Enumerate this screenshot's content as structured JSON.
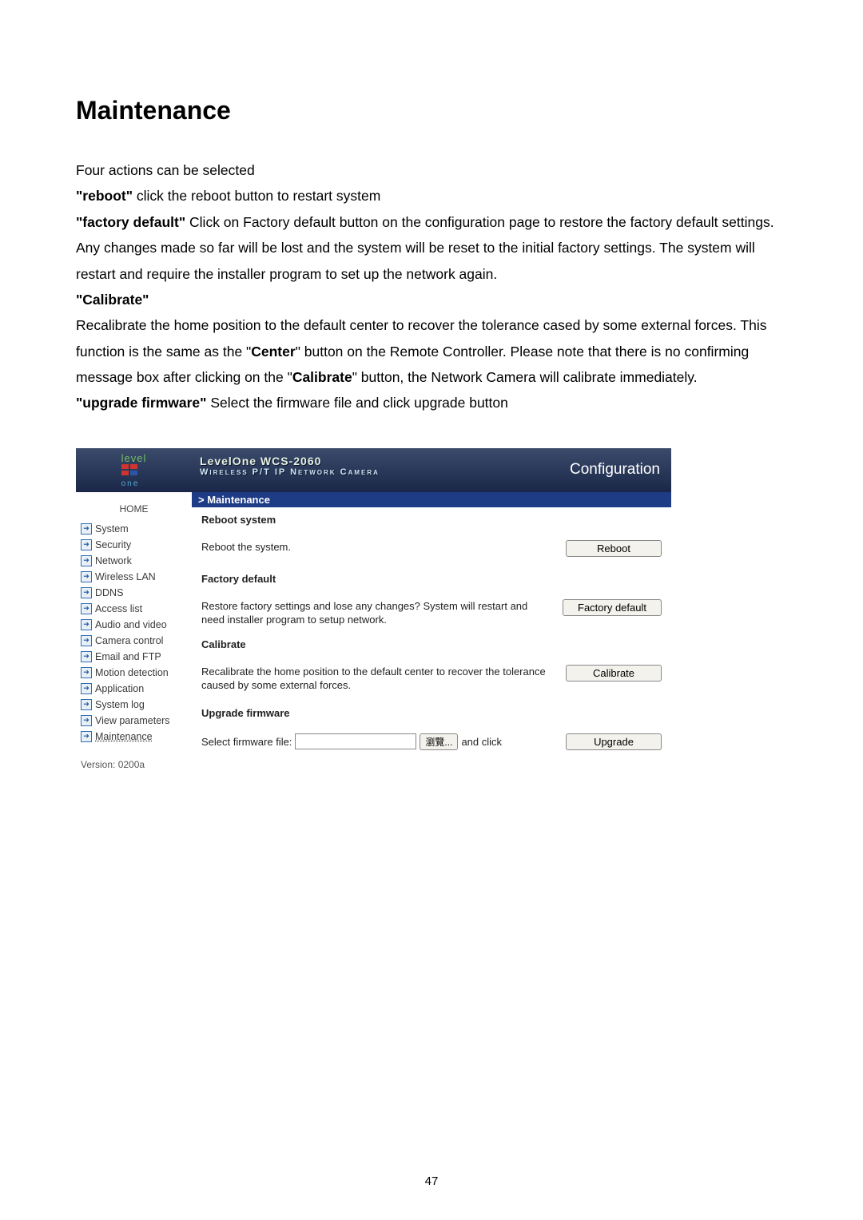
{
  "doc": {
    "title": "Maintenance",
    "intro": "Four actions can be selected",
    "reboot_label": "\"reboot\"",
    "reboot_text": " click the reboot button to restart system",
    "factory_label": "\"factory default\"",
    "factory_text": " Click on Factory default button on the configuration page to restore the factory default settings. Any changes made so far will be lost and the system will be reset to the initial factory settings. The system will restart and require the installer program to set up the network again.",
    "calibrate_label": "\"Calibrate\"",
    "calibrate_p1": "Recalibrate the home position to the default center to recover the tolerance cased by some external forces. This function is the same as the \"",
    "calibrate_center": "Center",
    "calibrate_p2": "\" button on the Remote Controller. Please note that there is no confirming message box after clicking on the \"",
    "calibrate_calib": "Calibrate",
    "calibrate_p3": "\" button, the Network Camera will calibrate immediately.",
    "upgrade_label": "\"upgrade firmware\"",
    "upgrade_text": " Select the firmware file and click upgrade button",
    "page_num": "47"
  },
  "shot": {
    "logo_top": "level",
    "logo_bottom": "one",
    "product": "LevelOne WCS-2060",
    "product_sub": "Wireless P/T IP Network Camera",
    "config_link": "Configuration",
    "sidebar": {
      "home": "HOME",
      "items": [
        {
          "label": "System"
        },
        {
          "label": "Security"
        },
        {
          "label": "Network"
        },
        {
          "label": "Wireless LAN"
        },
        {
          "label": "DDNS"
        },
        {
          "label": "Access list"
        },
        {
          "label": "Audio and video"
        },
        {
          "label": "Camera control"
        },
        {
          "label": "Email and FTP"
        },
        {
          "label": "Motion detection"
        },
        {
          "label": "Application"
        },
        {
          "label": "System log"
        },
        {
          "label": "View parameters"
        },
        {
          "label": "Maintenance"
        }
      ],
      "version": "Version: 0200a"
    },
    "main": {
      "crumb": "> Maintenance",
      "reboot_h": "Reboot system",
      "reboot_d": "Reboot the system.",
      "reboot_btn": "Reboot",
      "factory_h": "Factory default",
      "factory_d": "Restore factory settings and lose any changes? System will restart and need installer program to setup network.",
      "factory_btn": "Factory default",
      "calib_h": "Calibrate",
      "calib_d": "Recalibrate the home position to the default center to recover the tolerance caused by some external forces.",
      "calib_btn": "Calibrate",
      "upg_h": "Upgrade firmware",
      "upg_label": "Select firmware file:",
      "upg_browse": "瀏覽...",
      "upg_and": "and click",
      "upg_btn": "Upgrade"
    }
  }
}
